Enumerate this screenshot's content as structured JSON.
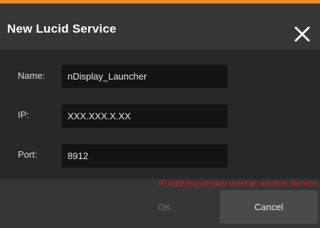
{
  "dialog": {
    "title": "New Lucid Service",
    "accent_color": "#f08a24"
  },
  "form": {
    "name": {
      "label": "Name:",
      "value": "nDisplay_Launcher"
    },
    "ip": {
      "label": "IP:",
      "value": "XXX.XXX.X.XX"
    },
    "port": {
      "label": "Port:",
      "value": "8912"
    }
  },
  "error": {
    "message": "IP address already used as another Service",
    "color": "#d11b1b"
  },
  "buttons": {
    "ok_label": "OK",
    "ok_state": "disabled",
    "cancel_label": "Cancel"
  },
  "icons": {
    "close": "close-icon"
  }
}
